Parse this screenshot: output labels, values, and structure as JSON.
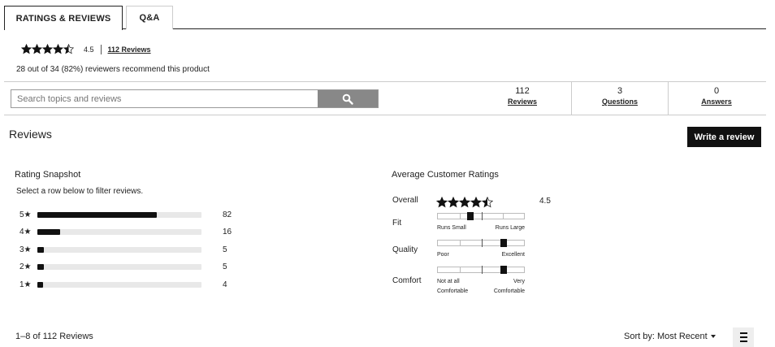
{
  "tabs": [
    {
      "label": "RATINGS & REVIEWS",
      "active": true
    },
    {
      "label": "Q&A",
      "active": false
    }
  ],
  "summary": {
    "rating": 4.5,
    "rating_text": "4.5",
    "reviews_link": "112 Reviews",
    "recommend_text": "28 out of 34 (82%) reviewers recommend this product"
  },
  "search": {
    "placeholder": "Search topics and reviews",
    "icon": "search-icon"
  },
  "stats": [
    {
      "value": "112",
      "label": "Reviews"
    },
    {
      "value": "3",
      "label": "Questions"
    },
    {
      "value": "0",
      "label": "Answers"
    }
  ],
  "reviews": {
    "title": "Reviews",
    "write_button": "Write a review"
  },
  "snapshot": {
    "title": "Rating Snapshot",
    "subtitle": "Select a row below to filter reviews.",
    "rows": [
      {
        "label": "5★",
        "count": "82",
        "fraction": 0.73
      },
      {
        "label": "4★",
        "count": "16",
        "fraction": 0.14
      },
      {
        "label": "3★",
        "count": "5",
        "fraction": 0.04
      },
      {
        "label": "2★",
        "count": "5",
        "fraction": 0.04
      },
      {
        "label": "1★",
        "count": "4",
        "fraction": 0.035
      }
    ]
  },
  "average": {
    "title": "Average Customer Ratings",
    "overall_label": "Overall",
    "overall_value": "4.5",
    "overall_rating": 4.5,
    "sliders": [
      {
        "label": "Fit",
        "left": "Runs Small",
        "right": "Runs Large",
        "position": 0.38
      },
      {
        "label": "Quality",
        "left": "Poor",
        "right": "Excellent",
        "position": 0.76
      },
      {
        "label": "Comfort",
        "left": "Not at all Comfortable",
        "right": "Very Comfortable",
        "position": 0.76
      }
    ]
  },
  "footer": {
    "count_text": "1–8 of 112 Reviews",
    "sort_label": "Sort by:",
    "sort_value": "Most Recent"
  },
  "colors": {
    "accent": "#111111",
    "search_button": "#888888",
    "bar_track": "#e8e8e8"
  }
}
